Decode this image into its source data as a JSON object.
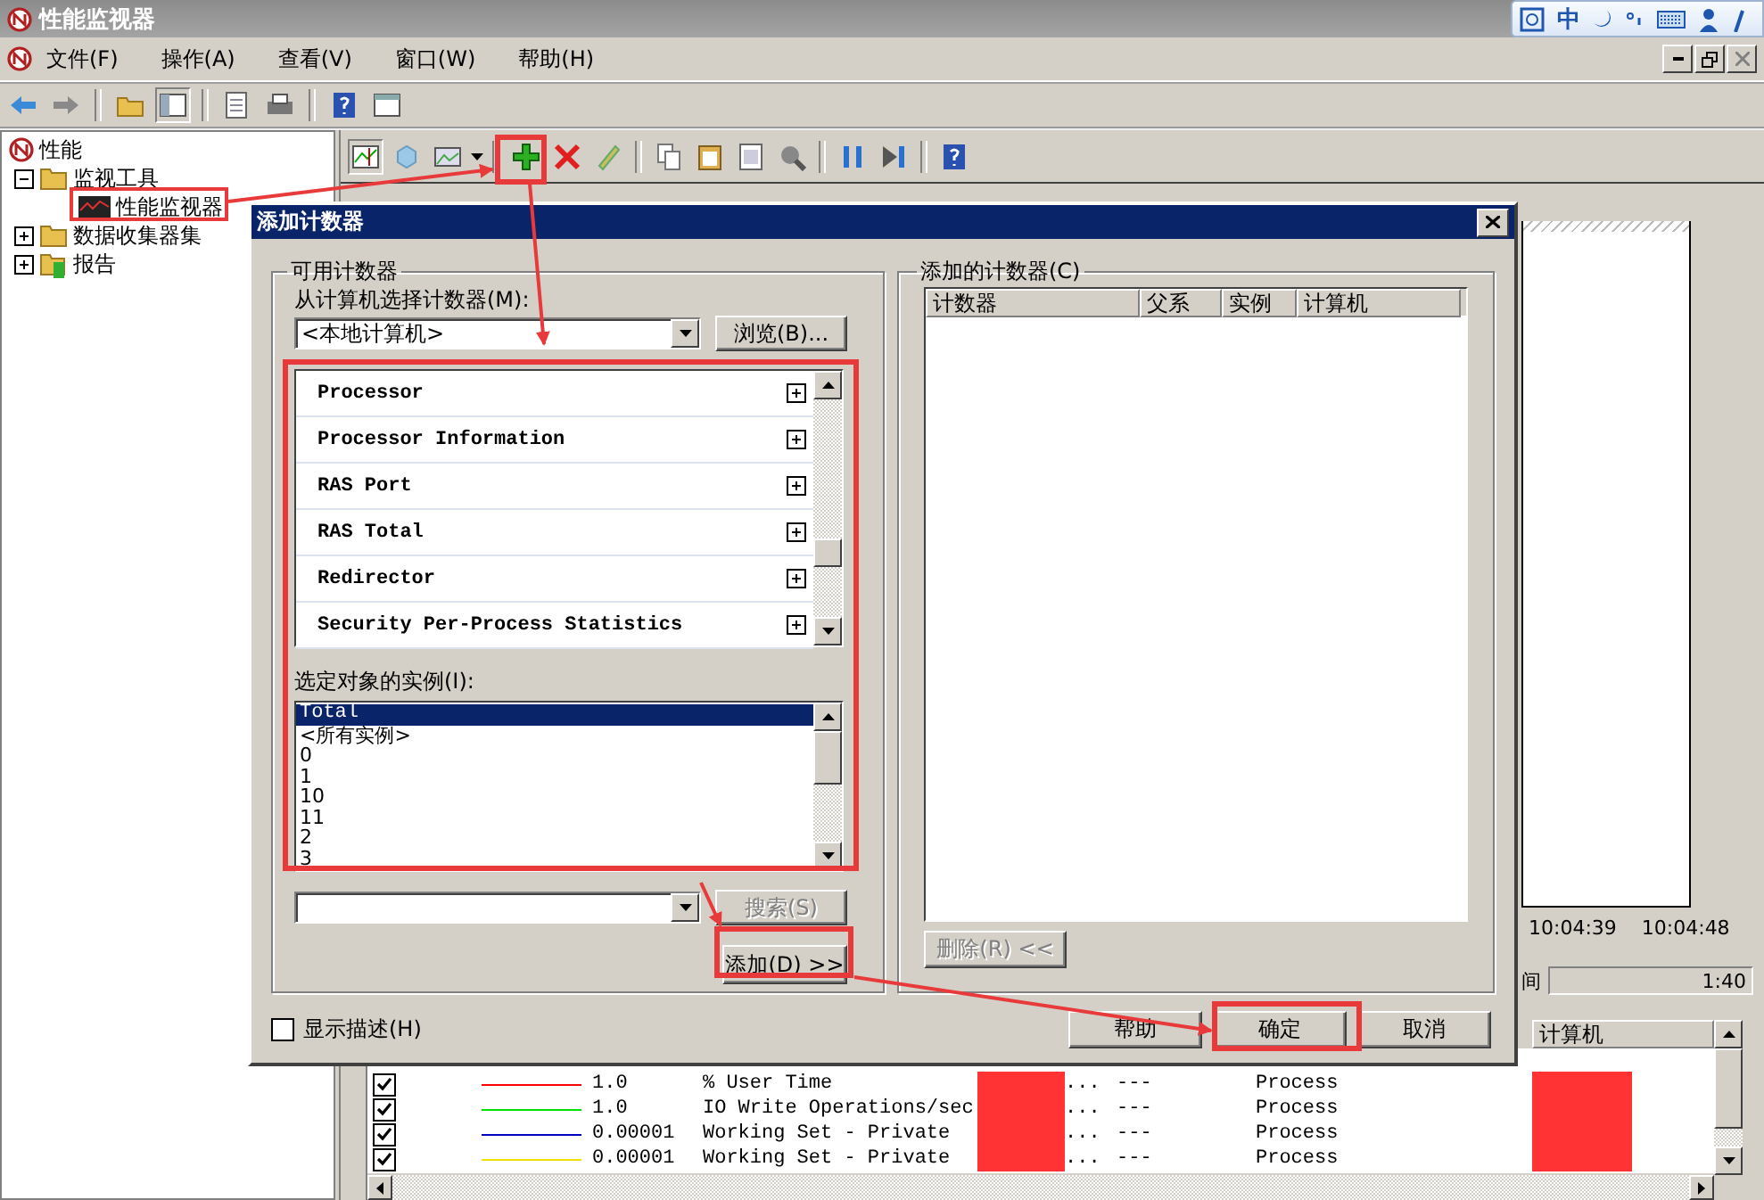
{
  "window": {
    "title": "性能监视器"
  },
  "ime_bar": {
    "mode": "中"
  },
  "menu": [
    {
      "label": "文件(F)"
    },
    {
      "label": "操作(A)"
    },
    {
      "label": "查看(V)"
    },
    {
      "label": "窗口(W)"
    },
    {
      "label": "帮助(H)"
    }
  ],
  "tree": [
    {
      "label": "性能",
      "kind": "root",
      "children": [
        {
          "label": "监视工具",
          "kind": "folder",
          "expanded": true,
          "children": [
            {
              "label": "性能监视器",
              "kind": "monitor"
            }
          ]
        },
        {
          "label": "数据收集器集",
          "kind": "folder",
          "expanded": false
        },
        {
          "label": "报告",
          "kind": "report",
          "expanded": false
        }
      ]
    }
  ],
  "graph": {
    "times": [
      "10:04:39",
      "10:04:48"
    ],
    "duration_label": "间",
    "duration": "1:40"
  },
  "legend": {
    "header": "计算机",
    "rows": [
      {
        "checked": true,
        "color": "#ff0000",
        "scale": "1.0",
        "counter": "% User Time",
        "instance": "...",
        "parent": "---",
        "object": "Process"
      },
      {
        "checked": true,
        "color": "#00e000",
        "scale": "1.0",
        "counter": "IO Write Operations/sec",
        "instance": "...",
        "parent": "---",
        "object": "Process"
      },
      {
        "checked": true,
        "color": "#0000c0",
        "scale": "0.00001",
        "counter": "Working Set - Private",
        "instance": "...",
        "parent": "---",
        "object": "Process"
      },
      {
        "checked": true,
        "color": "#f0e000",
        "scale": "0.00001",
        "counter": "Working Set - Private",
        "instance": "...",
        "parent": "---",
        "object": "Process"
      }
    ]
  },
  "dialog": {
    "title": "添加计数器",
    "available": {
      "title": "可用计数器",
      "computer_label": "从计算机选择计数器(M):",
      "computer": "<本地计算机>",
      "browse": "浏览(B)...",
      "objects": [
        {
          "name": "Processor",
          "expanded": false
        },
        {
          "name": "Processor Information",
          "expanded": false
        },
        {
          "name": "RAS Port",
          "expanded": false
        },
        {
          "name": "RAS Total",
          "expanded": false
        },
        {
          "name": "Redirector",
          "expanded": false
        },
        {
          "name": "Security Per-Process Statistics",
          "expanded": false
        }
      ],
      "instances_label": "选定对象的实例(I):",
      "instances": [
        {
          "label": "Total",
          "selected": true
        },
        {
          "label": "<所有实例>",
          "selected": false
        },
        {
          "label": "0",
          "selected": false
        },
        {
          "label": "1",
          "selected": false
        },
        {
          "label": "10",
          "selected": false
        },
        {
          "label": "11",
          "selected": false
        },
        {
          "label": "2",
          "selected": false
        },
        {
          "label": "3",
          "selected": false
        }
      ],
      "search": {
        "label": "搜索(S)",
        "disabled": true
      },
      "add": "添加(D) >>"
    },
    "added": {
      "title": "添加的计数器(C)",
      "columns": [
        "计数器",
        "父系",
        "实例",
        "计算机"
      ],
      "remove": {
        "label": "删除(R) <<",
        "disabled": true
      }
    },
    "show_description": {
      "label": "显示描述(H)",
      "checked": false
    },
    "buttons": [
      "帮助",
      "确定",
      "取消"
    ]
  }
}
